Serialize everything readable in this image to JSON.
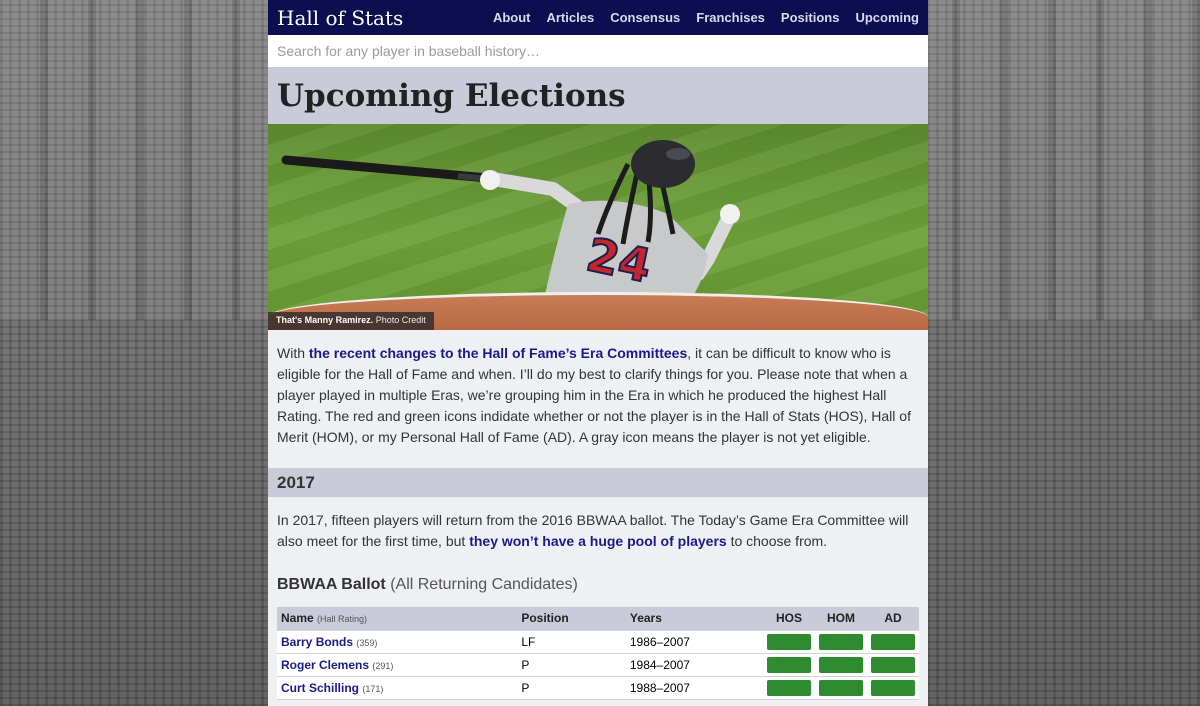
{
  "header": {
    "brand": "Hall of Stats",
    "nav": [
      "About",
      "Articles",
      "Consensus",
      "Franchises",
      "Positions",
      "Upcoming"
    ]
  },
  "search": {
    "placeholder": "Search for any player in baseball history…"
  },
  "page_title": "Upcoming Elections",
  "hero": {
    "caption_bold": "That's Manny Ramirez.",
    "caption_link": "Photo Credit",
    "jersey_number": "24"
  },
  "intro": {
    "before": "With ",
    "link": "the recent changes to the Hall of Fame’s Era Committees",
    "after": ", it can be difficult to know who is eligible for the Hall of Fame and when. I’ll do my best to clarify things for you. Please note that when a player played in multiple Eras, we’re grouping him in the Era in which he produced the highest Hall Rating. The red and green icons indidate whether or not the player is in the Hall of Stats (HOS), Hall of Merit (HOM), or my Personal Hall of Fame (AD). A gray icon means the player is not yet eligible."
  },
  "section_2017": {
    "heading": "2017",
    "before": "In 2017, fifteen players will return from the 2016 BBWAA ballot. The Today’s Game Era Committee will also meet for the first time, but ",
    "link": "they won’t have a huge pool of players",
    "after": " to choose from."
  },
  "ballot": {
    "title": "BBWAA Ballot",
    "subtitle": "(All Returning Candidates)",
    "columns": {
      "name": "Name",
      "name_note": "(Hall Rating)",
      "position": "Position",
      "years": "Years",
      "hos": "HOS",
      "hom": "HOM",
      "ad": "AD"
    },
    "rows": [
      {
        "name": "Barry Bonds",
        "rating": "(359)",
        "position": "LF",
        "years": "1986–2007",
        "hos": "in",
        "hom": "in",
        "ad": "in"
      },
      {
        "name": "Roger Clemens",
        "rating": "(291)",
        "position": "P",
        "years": "1984–2007",
        "hos": "in",
        "hom": "in",
        "ad": "in"
      },
      {
        "name": "Curt Schilling",
        "rating": "(171)",
        "position": "P",
        "years": "1988–2007",
        "hos": "in",
        "hom": "in",
        "ad": "in"
      }
    ]
  },
  "colors": {
    "nav_bg": "#0c0e4f",
    "band_bg": "#c9cbd8",
    "link": "#1a1a8a",
    "status_in": "#2e8b2f"
  }
}
